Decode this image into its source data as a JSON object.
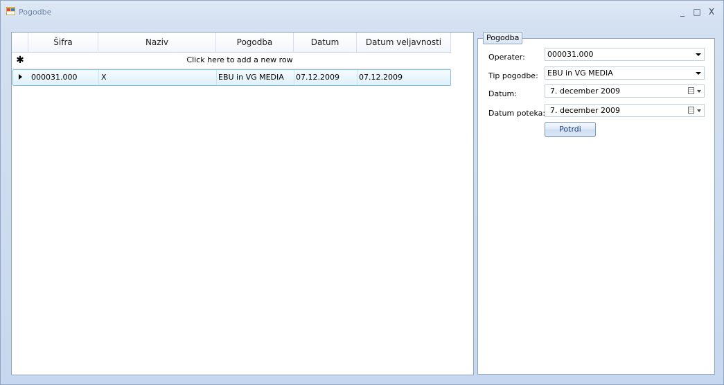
{
  "window": {
    "title": "Pogodbe",
    "minimize_label": "_",
    "maximize_label": "□",
    "close_label": "X"
  },
  "grid": {
    "columns": [
      "Šifra",
      "Naziv",
      "Pogodba",
      "Datum",
      "Datum veljavnosti"
    ],
    "new_row_icon": "✱",
    "new_row_text": "Click here to add a new row",
    "rows": [
      {
        "sifra": "000031.000",
        "naziv": "X",
        "pogodba": "EBU in VG MEDIA",
        "datum": "07.12.2009",
        "datum_veljavnosti": "07.12.2009"
      }
    ]
  },
  "form": {
    "group_title": "Pogodba",
    "operater_label": "Operater:",
    "operater_value": "000031.000",
    "tip_label": "Tip pogodbe:",
    "tip_value": "EBU in VG MEDIA",
    "datum_label": "Datum:",
    "datum_value": "7. december 2009",
    "poteka_label": "Datum poteka:",
    "poteka_value": "7. december 2009",
    "submit_label": "Potrdi"
  },
  "icons": {
    "window": "app-window-icon",
    "calendar": "calendar-icon",
    "dropdown": "chevron-down-icon",
    "row_indicator": "row-pointer-icon",
    "new_row": "asterisk-icon"
  }
}
